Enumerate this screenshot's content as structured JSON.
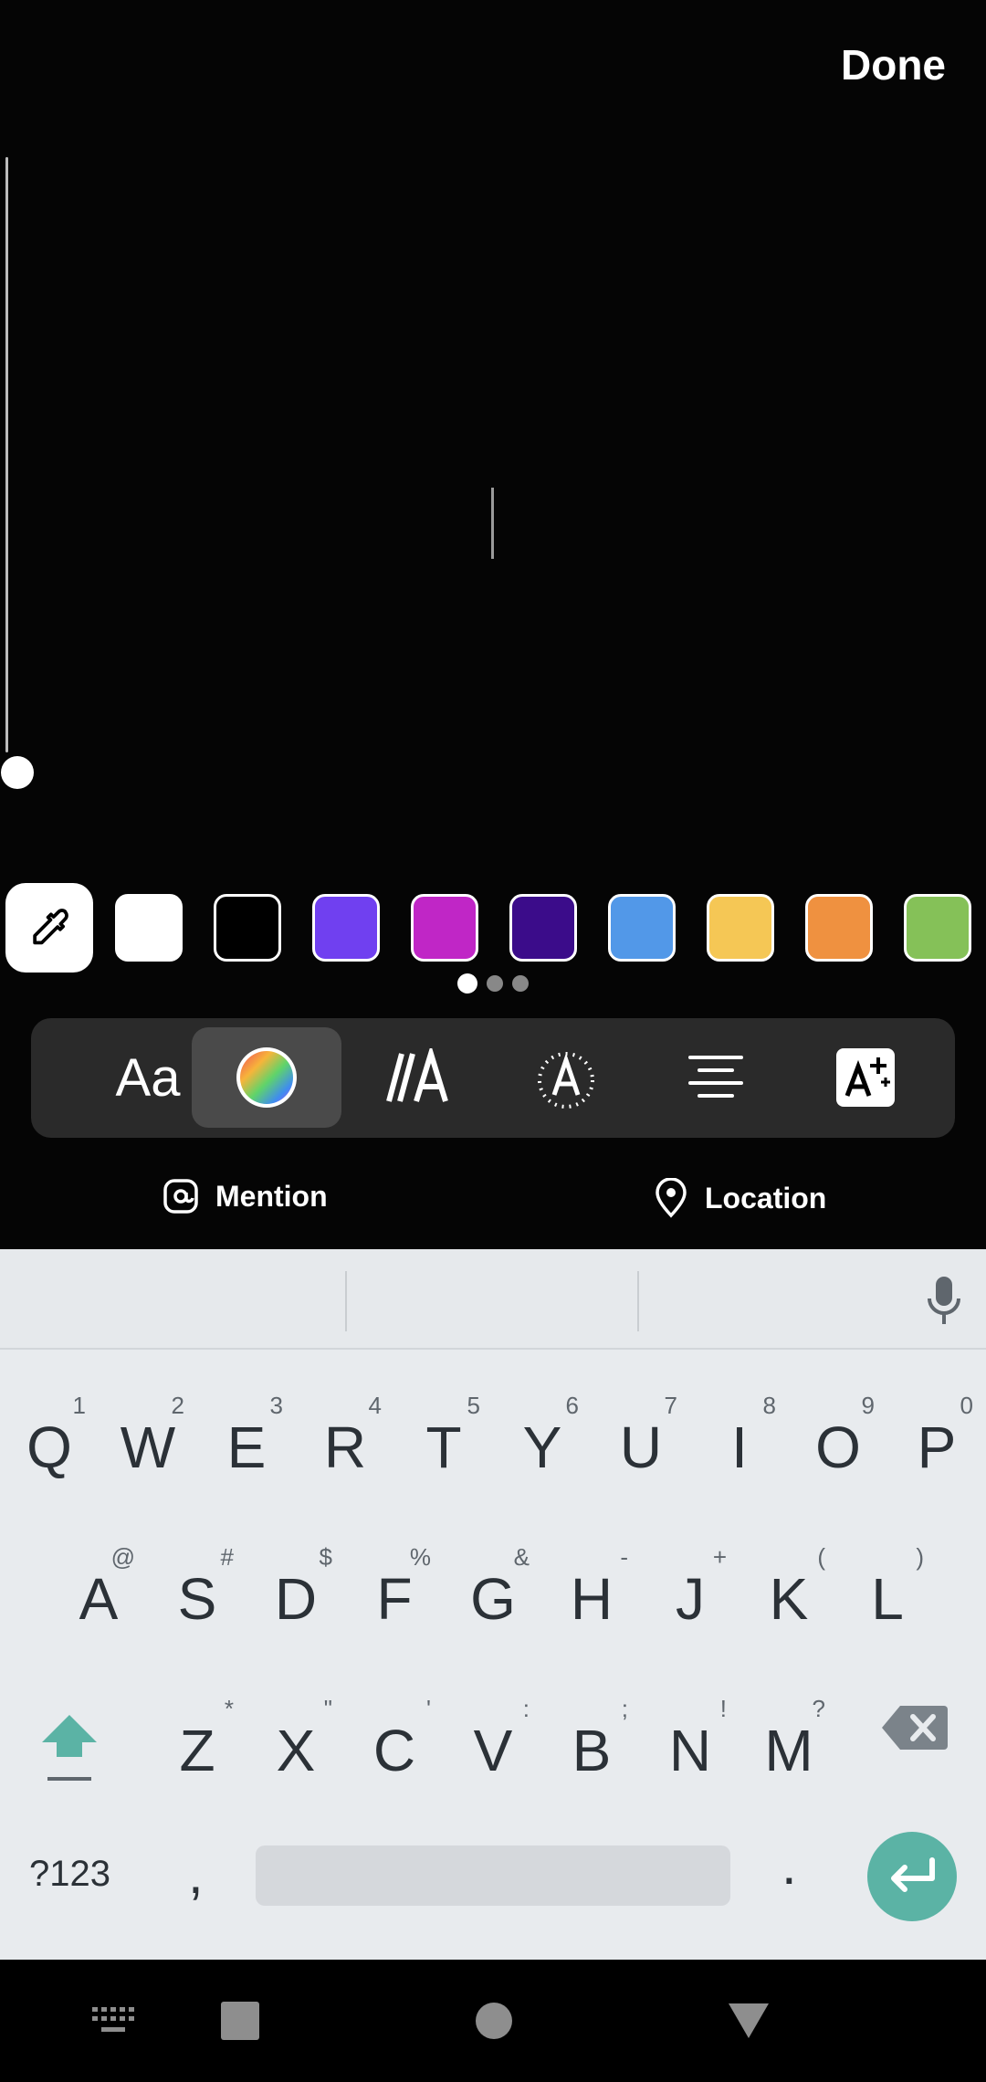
{
  "header": {
    "done_label": "Done"
  },
  "color_palette": {
    "swatches": [
      "#ffffff",
      "#000000",
      "#7040f0",
      "#c026c6",
      "#3b0c8a",
      "#5298e8",
      "#f5c755",
      "#ef9140",
      "#85c158"
    ],
    "pages": 3,
    "active_page": 1
  },
  "toolbar": {
    "font_label": "Aa",
    "tools": [
      "font-icon",
      "color-wheel-icon",
      "text-style-icon",
      "animation-icon",
      "align-center-icon",
      "effects-icon"
    ],
    "selected": "color-wheel-icon"
  },
  "mentions": {
    "mention_label": "Mention",
    "location_label": "Location"
  },
  "keyboard": {
    "row1": [
      {
        "key": "Q",
        "alt": "1"
      },
      {
        "key": "W",
        "alt": "2"
      },
      {
        "key": "E",
        "alt": "3"
      },
      {
        "key": "R",
        "alt": "4"
      },
      {
        "key": "T",
        "alt": "5"
      },
      {
        "key": "Y",
        "alt": "6"
      },
      {
        "key": "U",
        "alt": "7"
      },
      {
        "key": "I",
        "alt": "8"
      },
      {
        "key": "O",
        "alt": "9"
      },
      {
        "key": "P",
        "alt": "0"
      }
    ],
    "row2": [
      {
        "key": "A",
        "alt": "@"
      },
      {
        "key": "S",
        "alt": "#"
      },
      {
        "key": "D",
        "alt": "$"
      },
      {
        "key": "F",
        "alt": "%"
      },
      {
        "key": "G",
        "alt": "&"
      },
      {
        "key": "H",
        "alt": "-"
      },
      {
        "key": "J",
        "alt": "+"
      },
      {
        "key": "K",
        "alt": "("
      },
      {
        "key": "L",
        "alt": ")"
      }
    ],
    "row3": [
      {
        "key": "Z",
        "alt": "*"
      },
      {
        "key": "X",
        "alt": "\""
      },
      {
        "key": "C",
        "alt": "'"
      },
      {
        "key": "V",
        "alt": ":"
      },
      {
        "key": "B",
        "alt": ";"
      },
      {
        "key": "N",
        "alt": "!"
      },
      {
        "key": "M",
        "alt": "?"
      }
    ],
    "symbols_label": "?123",
    "comma_label": ",",
    "period_label": ".",
    "accent_color": "#5bb3a5"
  },
  "navbar": {
    "items": [
      "keyboard-icon",
      "recents-icon",
      "home-icon",
      "back-icon"
    ]
  }
}
